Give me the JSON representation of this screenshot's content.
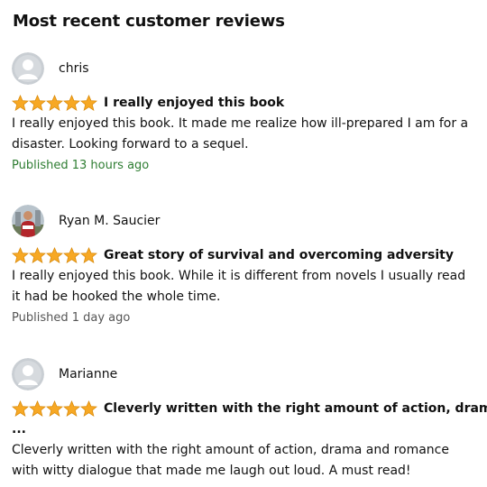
{
  "heading": "Most recent customer reviews",
  "colors": {
    "star": "#F7A824",
    "published_recent": "#2E7D32",
    "published_older": "#555555"
  },
  "reviews": [
    {
      "author": "chris",
      "avatar": "default-avatar",
      "rating": 5,
      "title": "I really enjoyed this book",
      "body_lines": [
        "I really enjoyed this book. It made me realize how ill-prepared I am for a",
        "disaster. Looking forward to a sequel."
      ],
      "published": "Published 13 hours ago"
    },
    {
      "author": "Ryan M. Saucier",
      "avatar": "photo-avatar",
      "rating": 5,
      "title": "Great story of survival and overcoming adversity",
      "body_lines": [
        "I really enjoyed this book. While it is different from novels I usually read",
        "it had be hooked the whole time."
      ],
      "published": "Published 1 day ago"
    },
    {
      "author": "Marianne",
      "avatar": "default-avatar",
      "rating": 5,
      "title": "Cleverly written with the right amount of action, drama",
      "title_continuation": "...",
      "body_lines": [
        "Cleverly written with the right amount of action, drama and romance",
        "with witty dialogue that made me laugh out loud. A must read!"
      ]
    }
  ]
}
